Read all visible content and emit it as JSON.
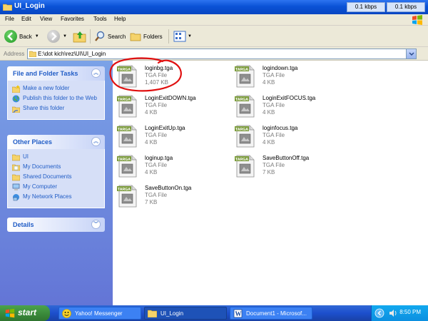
{
  "window": {
    "title": "UI_Login"
  },
  "status": {
    "kbps_1": "0.1 kbps",
    "kbps_2": "0.1 kbps"
  },
  "menu": [
    "File",
    "Edit",
    "View",
    "Favorites",
    "Tools",
    "Help"
  ],
  "toolbar": {
    "back": "Back",
    "search": "Search",
    "folders": "Folders"
  },
  "address": {
    "label": "Address",
    "path": "E:\\dot kich\\rez\\UI\\UI_Login"
  },
  "tasks_panel": {
    "title": "File and Folder Tasks",
    "items": [
      {
        "label": "Make a new folder",
        "icon": "new-folder-icon"
      },
      {
        "label": "Publish this folder to the Web",
        "icon": "globe-icon"
      },
      {
        "label": "Share this folder",
        "icon": "share-icon"
      }
    ]
  },
  "places_panel": {
    "title": "Other Places",
    "items": [
      {
        "label": "UI",
        "icon": "folder-icon"
      },
      {
        "label": "My Documents",
        "icon": "documents-icon"
      },
      {
        "label": "Shared Documents",
        "icon": "folder-icon"
      },
      {
        "label": "My Computer",
        "icon": "computer-icon"
      },
      {
        "label": "My Network Places",
        "icon": "network-icon"
      }
    ]
  },
  "details_panel": {
    "title": "Details"
  },
  "files": [
    {
      "name": "loginbg.tga",
      "type": "TGA File",
      "size": "1,407 KB"
    },
    {
      "name": "logindown.tga",
      "type": "TGA File",
      "size": "4 KB"
    },
    {
      "name": "LoginExitDOWN.tga",
      "type": "TGA File",
      "size": "4 KB"
    },
    {
      "name": "LoginExitFOCUS.tga",
      "type": "TGA File",
      "size": "4 KB"
    },
    {
      "name": "LoginExitUp.tga",
      "type": "TGA File",
      "size": "4 KB"
    },
    {
      "name": "loginfocus.tga",
      "type": "TGA File",
      "size": "4 KB"
    },
    {
      "name": "loginup.tga",
      "type": "TGA File",
      "size": "4 KB"
    },
    {
      "name": "SaveButtonOff.tga",
      "type": "TGA File",
      "size": "7 KB"
    },
    {
      "name": "SaveButtonOn.tga",
      "type": "TGA File",
      "size": "7 KB"
    }
  ],
  "icon_badge": "TARGA",
  "taskbar": {
    "start": "start",
    "items": [
      "Yahoo! Messenger",
      "UI_Login",
      "Document1 - Microsof..."
    ],
    "clock": "8:50 PM"
  },
  "colors": {
    "accent": "#215dc6",
    "titlebar": "#0a52d6",
    "pane": "#7ba2e7",
    "annotation": "#e01010"
  }
}
